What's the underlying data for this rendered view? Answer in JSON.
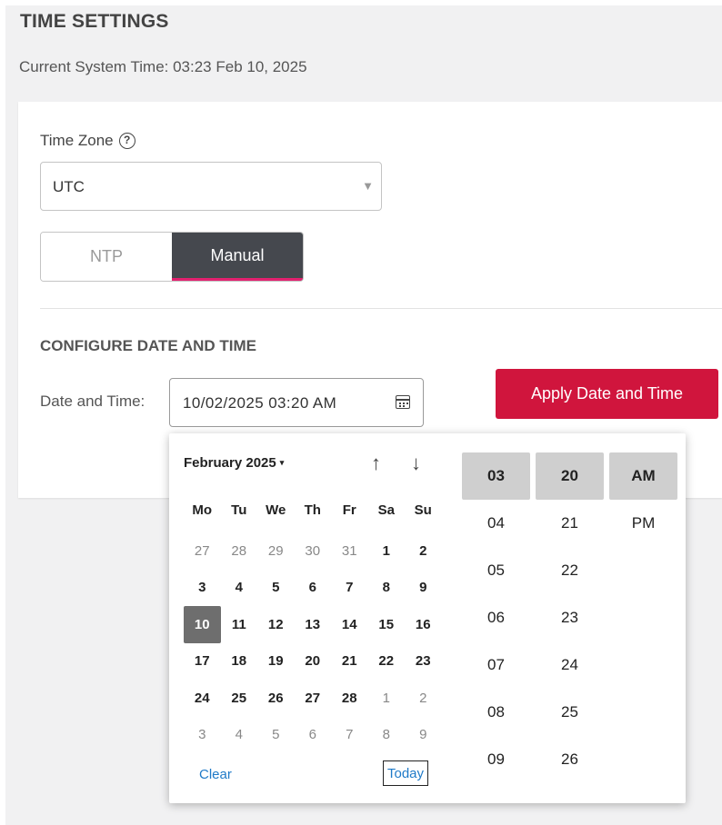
{
  "page": {
    "title": "TIME SETTINGS",
    "current_time": "Current System Time: 03:23 Feb 10, 2025"
  },
  "timezone": {
    "label": "Time Zone",
    "help_icon": "?",
    "value": "UTC",
    "caret_icon": "▼"
  },
  "mode_toggle": {
    "options": [
      "NTP",
      "Manual"
    ],
    "selected": "Manual"
  },
  "configure": {
    "heading": "CONFIGURE DATE AND TIME",
    "label": "Date and Time:",
    "value": "10/02/2025 03:20 AM",
    "icon": "calendar-icon",
    "apply_label": "Apply Date and Time"
  },
  "picker": {
    "month_label": "February 2025",
    "month_caret": "▾",
    "nav_up": "↑",
    "nav_down": "↓",
    "weekdays": [
      "Mo",
      "Tu",
      "We",
      "Th",
      "Fr",
      "Sa",
      "Su"
    ],
    "weeks": [
      [
        "27",
        "28",
        "29",
        "30",
        "31",
        "1",
        "2"
      ],
      [
        "3",
        "4",
        "5",
        "6",
        "7",
        "8",
        "9"
      ],
      [
        "10",
        "11",
        "12",
        "13",
        "14",
        "15",
        "16"
      ],
      [
        "17",
        "18",
        "19",
        "20",
        "21",
        "22",
        "23"
      ],
      [
        "24",
        "25",
        "26",
        "27",
        "28",
        "1",
        "2"
      ],
      [
        "3",
        "4",
        "5",
        "6",
        "7",
        "8",
        "9"
      ]
    ],
    "selected_day": "10",
    "clear_label": "Clear",
    "today_label": "Today",
    "hours": [
      "03",
      "04",
      "05",
      "06",
      "07",
      "08",
      "09"
    ],
    "minutes": [
      "20",
      "21",
      "22",
      "23",
      "24",
      "25",
      "26"
    ],
    "ampm": [
      "AM",
      "PM"
    ],
    "selected_hour": "03",
    "selected_minute": "20",
    "selected_ampm": "AM"
  },
  "colors": {
    "accent_red": "#d0153d",
    "toggle_active_bg": "#45484e",
    "toggle_underline": "#e3216f",
    "link_blue": "#1f7ac8",
    "selected_day_bg": "#6e6e6e",
    "selected_time_bg": "#cfcfcf"
  }
}
